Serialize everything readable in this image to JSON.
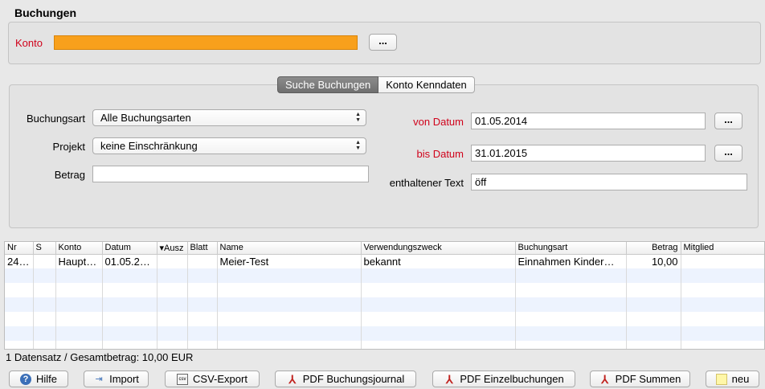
{
  "section_title": "Buchungen",
  "konto": {
    "label": "Konto",
    "bar_color": "#f8a01c",
    "browse_label": "..."
  },
  "tabs": [
    {
      "label": "Suche Buchungen",
      "active": true
    },
    {
      "label": "Konto Kenndaten",
      "active": false
    }
  ],
  "search": {
    "buchungsart_label": "Buchungsart",
    "buchungsart_value": "Alle Buchungsarten",
    "projekt_label": "Projekt",
    "projekt_value": "keine Einschränkung",
    "betrag_label": "Betrag",
    "betrag_value": "",
    "von_label": "von Datum",
    "von_value": "01.05.2014",
    "bis_label": "bis Datum",
    "bis_value": "31.01.2015",
    "text_label": "enthaltener Text",
    "text_value": "öff",
    "browse_label": "..."
  },
  "table": {
    "columns": [
      "Nr",
      "S",
      "Konto",
      "Datum",
      "Ausz",
      "Blatt",
      "Name",
      "Verwendungszweck",
      "Buchungsart",
      "Betrag",
      "Mitglied"
    ],
    "sort_indicator": "▾",
    "rows": [
      [
        "24…",
        "",
        "Haupt…",
        "01.05.2…",
        "",
        "",
        "Meier-Test",
        "bekannt",
        "Einnahmen Kinder…",
        "10,00",
        ""
      ]
    ]
  },
  "status": "1 Datensatz / Gesamtbetrag: 10,00 EUR",
  "buttons": {
    "help": "Hilfe",
    "import": "Import",
    "csv": "CSV-Export",
    "csv_icon_text": "csv",
    "pdf_journal": "PDF Buchungsjournal",
    "pdf_single": "PDF Einzelbuchungen",
    "pdf_sums": "PDF Summen",
    "new": "neu"
  },
  "colors": {
    "required_label": "#d0021b",
    "row_alt": "#edf3fe"
  }
}
